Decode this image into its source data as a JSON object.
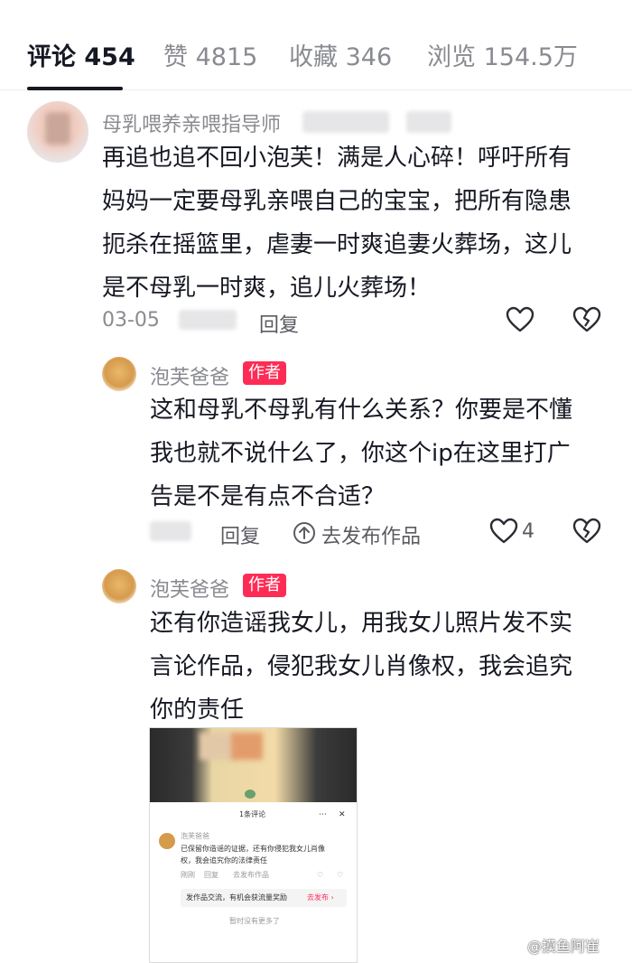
{
  "tabs": {
    "comments": "评论 454",
    "likes": "赞 4815",
    "favorites": "收藏 346",
    "views": "浏览 154.5万"
  },
  "comments": [
    {
      "username": "母乳喂养亲喂指导师",
      "text_lines": [
        "再追也追不回小泡芙！满是人心碎！呼吁所有",
        "妈妈一定要母乳亲喂自己的宝宝，把所有隐患",
        "扼杀在摇篮里，虐妻一时爽追妻火葬场，这儿",
        "是不母乳一时爽，追儿火葬场！"
      ],
      "date": "03-05",
      "reply_label": "回复",
      "like_icon": "heart-outline-icon",
      "dislike_icon": "broken-heart-icon"
    }
  ],
  "replies": [
    {
      "username": "泡芙爸爸",
      "badge": "作者",
      "text_lines": [
        "这和母乳不母乳有什么关系？你要是不懂",
        "我也就不说什么了，你这个ip在这里打广",
        "告是不是有点不合适？"
      ],
      "reply_label": "回复",
      "publish_label": "去发布作品",
      "like_count": "4"
    },
    {
      "username": "泡芙爸爸",
      "badge": "作者",
      "text_lines": [
        "还有你造谣我女儿，用我女儿照片发不实",
        "言论作品，侵犯我女儿肖像权，我会追究",
        "你的责任"
      ]
    }
  ],
  "embedded_screenshot": {
    "header": "1条评论",
    "username": "泡芙爸爸 ",
    "text_lines": [
      "已保留你造谣的证据，还有你侵犯我女儿肖像",
      "权，我会追究你的法律责任"
    ],
    "meta_date": "刚刚",
    "meta_reply": "回复",
    "meta_publish": "去发布作品",
    "banner_text": "发作品交流，有机会获流量奖励",
    "banner_action": "去发布 ›",
    "footer": "暂时没有更多了"
  },
  "watermark": "@摸鱼阿崔",
  "colors": {
    "accent": "#fe2c55",
    "text": "#161823",
    "muted": "#8a8b91"
  }
}
